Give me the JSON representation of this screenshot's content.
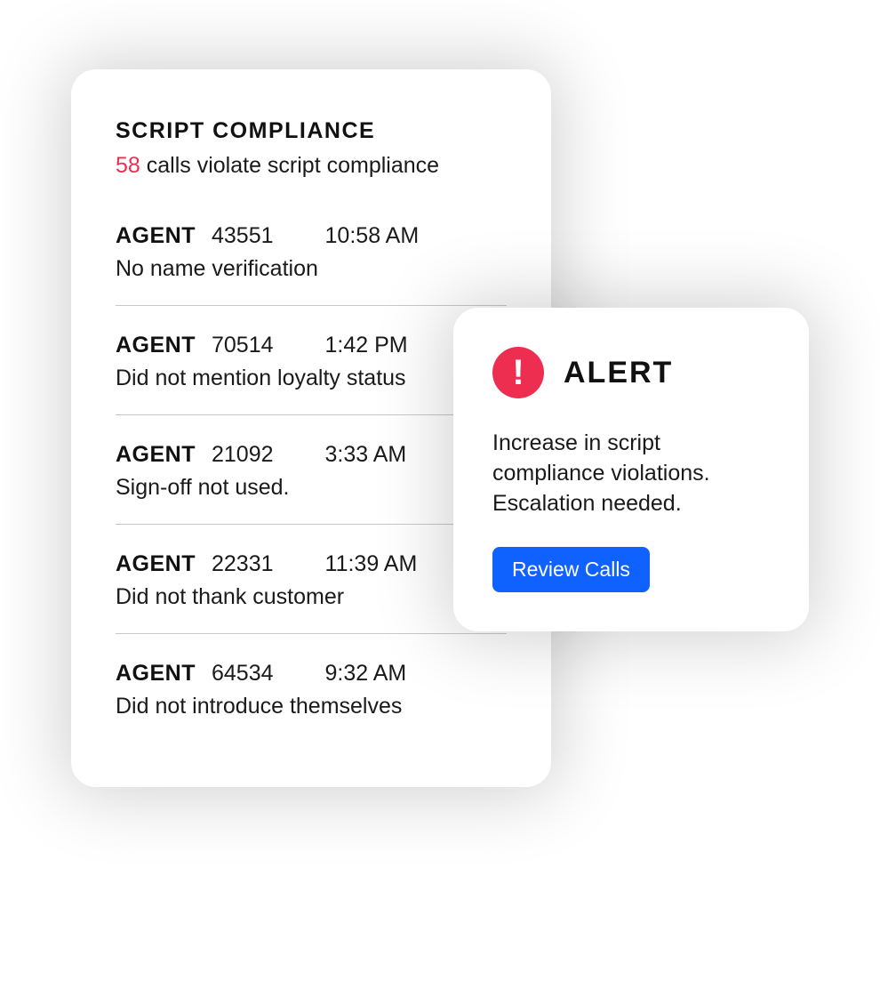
{
  "compliance": {
    "title": "SCRIPT COMPLIANCE",
    "violation_count": "58",
    "subtitle_suffix": " calls violate script compliance",
    "agent_label": "AGENT",
    "rows": [
      {
        "id": "43551",
        "time": "10:58 AM",
        "reason": "No name verification"
      },
      {
        "id": "70514",
        "time": "1:42 PM",
        "reason": "Did not mention loyalty status"
      },
      {
        "id": "21092",
        "time": "3:33 AM",
        "reason": "Sign-off not used."
      },
      {
        "id": "22331",
        "time": "11:39 AM",
        "reason": "Did not thank customer"
      },
      {
        "id": "64534",
        "time": "9:32 AM",
        "reason": "Did not introduce themselves"
      }
    ]
  },
  "alert": {
    "title": "ALERT",
    "body": "Increase in script compliance violations. Escalation needed.",
    "button_label": "Review Calls"
  },
  "colors": {
    "accent_red": "#ee2e51",
    "primary_blue": "#0f62fe"
  }
}
